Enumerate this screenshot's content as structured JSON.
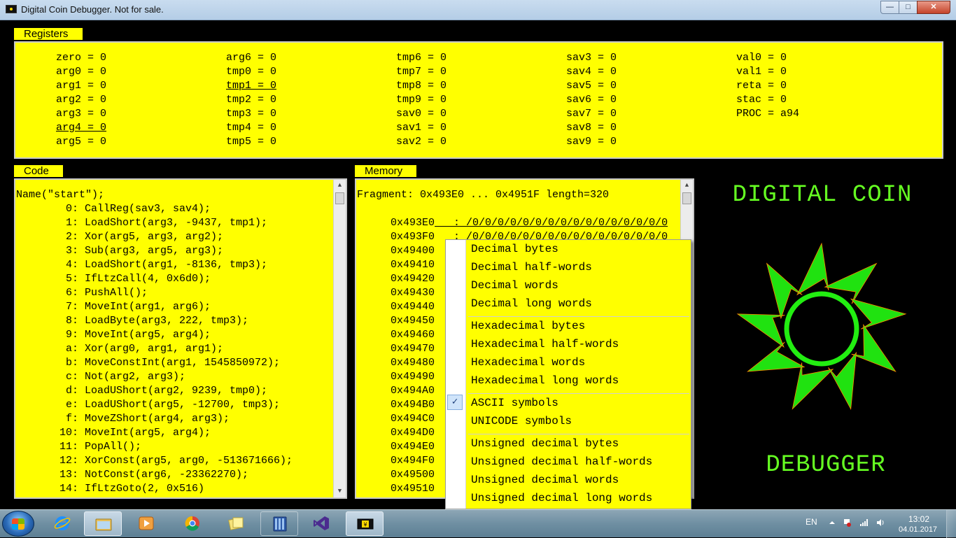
{
  "window": {
    "title": "Digital Coin Debugger. Not for sale.",
    "buttons": {
      "minimize": "—",
      "maximize": "□",
      "close": "✕"
    }
  },
  "registers": {
    "label": "Registers",
    "columns": [
      [
        "zero = 0",
        "arg0 = 0",
        "arg1 = 0",
        "arg2 = 0",
        "arg3 = 0",
        "arg4 = 0",
        "arg5 = 0"
      ],
      [
        "arg6 = 0",
        "tmp0 = 0",
        "tmp1 = 0",
        "tmp2 = 0",
        "tmp3 = 0",
        "tmp4 = 0",
        "tmp5 = 0"
      ],
      [
        "tmp6 = 0",
        "tmp7 = 0",
        "tmp8 = 0",
        "tmp9 = 0",
        "sav0 = 0",
        "sav1 = 0",
        "sav2 = 0"
      ],
      [
        "sav3 = 0",
        "sav4 = 0",
        "sav5 = 0",
        "sav6 = 0",
        "sav7 = 0",
        "sav8 = 0",
        "sav9 = 0"
      ],
      [
        "val0 = 0",
        "val1 = 0",
        "reta = 0",
        "stac = 0",
        "PROC = a94"
      ]
    ],
    "underlined": [
      "arg4",
      "tmp1"
    ]
  },
  "code": {
    "label": "Code",
    "header": "Name(\"start\");",
    "lines": [
      {
        "addr": "0",
        "instr": "CallReg(sav3, sav4);"
      },
      {
        "addr": "1",
        "instr": "LoadShort(arg3, -9437, tmp1);"
      },
      {
        "addr": "2",
        "instr": "Xor(arg5, arg3, arg2);"
      },
      {
        "addr": "3",
        "instr": "Sub(arg3, arg5, arg3);"
      },
      {
        "addr": "4",
        "instr": "LoadShort(arg1, -8136, tmp3);"
      },
      {
        "addr": "5",
        "instr": "IfLtzCall(4, 0x6d0);"
      },
      {
        "addr": "6",
        "instr": "PushAll();"
      },
      {
        "addr": "7",
        "instr": "MoveInt(arg1, arg6);"
      },
      {
        "addr": "8",
        "instr": "LoadByte(arg3, 222, tmp3);"
      },
      {
        "addr": "9",
        "instr": "MoveInt(arg5, arg4);"
      },
      {
        "addr": "a",
        "instr": "Xor(arg0, arg1, arg1);"
      },
      {
        "addr": "b",
        "instr": "MoveConstInt(arg1, 1545850972);"
      },
      {
        "addr": "c",
        "instr": "Not(arg2, arg3);"
      },
      {
        "addr": "d",
        "instr": "LoadUShort(arg2, 9239, tmp0);"
      },
      {
        "addr": "e",
        "instr": "LoadUShort(arg5, -12700, tmp3);"
      },
      {
        "addr": "f",
        "instr": "MoveZShort(arg4, arg3);"
      },
      {
        "addr": "10",
        "instr": "MoveInt(arg5, arg4);"
      },
      {
        "addr": "11",
        "instr": "PopAll();"
      },
      {
        "addr": "12",
        "instr": "XorConst(arg5, arg0, -513671666);"
      },
      {
        "addr": "13",
        "instr": "NotConst(arg6, -23362270);"
      },
      {
        "addr": "14",
        "instr": "IfLtzGoto(2, 0x516)"
      }
    ]
  },
  "memory": {
    "label": "Memory",
    "fragment": "Fragment: 0x493E0 ... 0x4951F length=320",
    "first_row_data": "   : /0/0/0/0/0/0/0/0/0/0/0/0/0/0/0/0",
    "second_row_data": "   : /0/0/0/0/0/0/0/0/0/0/0/0/0/0/0/0",
    "addresses": [
      "0x493E0",
      "0x493F0",
      "0x49400",
      "0x49410",
      "0x49420",
      "0x49430",
      "0x49440",
      "0x49450",
      "0x49460",
      "0x49470",
      "0x49480",
      "0x49490",
      "0x494A0",
      "0x494B0",
      "0x494C0",
      "0x494D0",
      "0x494E0",
      "0x494F0",
      "0x49500",
      "0x49510"
    ]
  },
  "brand": {
    "title": "DIGITAL COIN",
    "subtitle": "DEBUGGER",
    "accent": "#66ff22"
  },
  "context_menu": {
    "groups": [
      [
        "Decimal bytes",
        "Decimal half-words",
        "Decimal words",
        "Decimal long words"
      ],
      [
        "Hexadecimal bytes",
        "Hexadecimal half-words",
        "Hexadecimal words",
        "Hexadecimal long words"
      ],
      [
        "ASCII symbols",
        "UNICODE symbols"
      ],
      [
        "Unsigned decimal bytes",
        "Unsigned decimal half-words",
        "Unsigned decimal words",
        "Unsigned decimal long words"
      ]
    ],
    "checked": "ASCII symbols",
    "check_glyph": "✓"
  },
  "colors": {
    "panel_bg": "#ffff00",
    "window_bg": "#000000",
    "title_bar": "#c9dcef"
  },
  "taskbar": {
    "apps": [
      {
        "name": "internet-explorer-icon"
      },
      {
        "name": "file-explorer-icon"
      },
      {
        "name": "media-player-icon"
      },
      {
        "name": "chrome-icon"
      },
      {
        "name": "sticky-notes-icon"
      },
      {
        "name": "calculator-app-icon"
      },
      {
        "name": "visual-studio-icon"
      },
      {
        "name": "digital-coin-debugger-icon"
      }
    ],
    "language": "EN",
    "time": "13:02",
    "date": "04.01.2017"
  }
}
